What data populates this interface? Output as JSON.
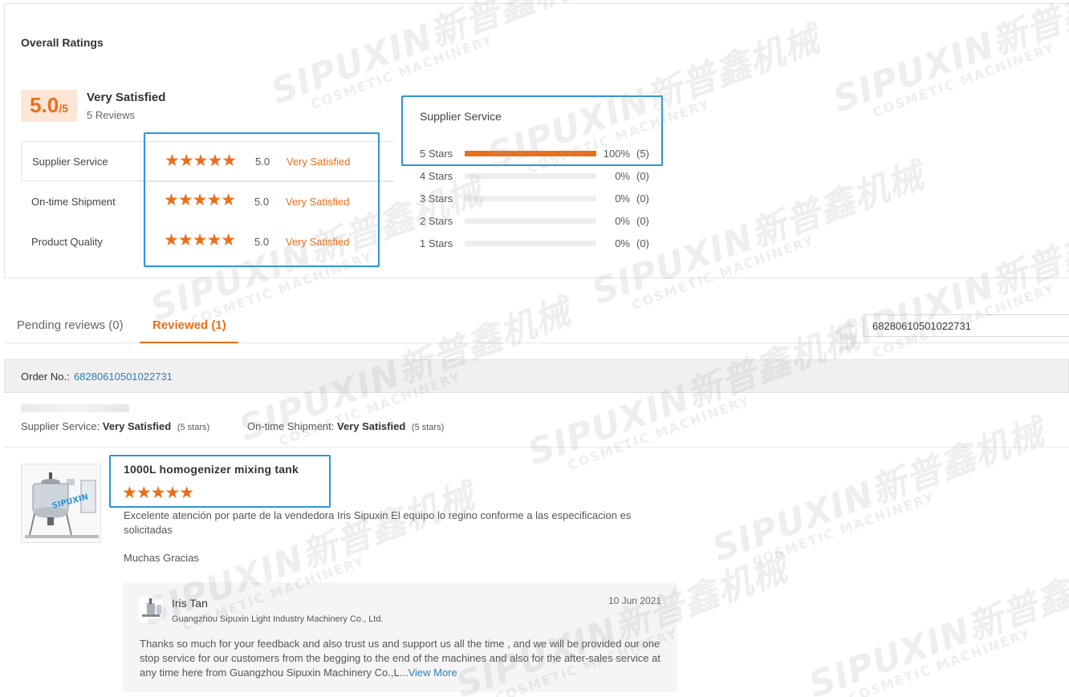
{
  "overall": {
    "title": "Overall Ratings",
    "score": "5.0",
    "score_max": "/5",
    "satisfaction": "Very Satisfied",
    "reviews": "5 Reviews"
  },
  "categories": [
    {
      "label": "Supplier Service",
      "rating": 5,
      "score": "5.0",
      "desc": "Very Satisfied"
    },
    {
      "label": "On-time Shipment",
      "rating": 5,
      "score": "5.0",
      "desc": "Very Satisfied"
    },
    {
      "label": "Product Quality",
      "rating": 5,
      "score": "5.0",
      "desc": "Very Satisfied"
    }
  ],
  "distribution": {
    "title": "Supplier Service",
    "rows": [
      {
        "label": "5  Stars",
        "pct": "100%",
        "count": "(5)",
        "fraction": 1.0
      },
      {
        "label": "4  Stars",
        "pct": "0%",
        "count": "(0)",
        "fraction": 0
      },
      {
        "label": "3  Stars",
        "pct": "0%",
        "count": "(0)",
        "fraction": 0
      },
      {
        "label": "2  Stars",
        "pct": "0%",
        "count": "(0)",
        "fraction": 0
      },
      {
        "label": "1  Stars",
        "pct": "0%",
        "count": "(0)",
        "fraction": 0
      }
    ]
  },
  "tabs": [
    {
      "label": "Pending reviews (0)",
      "active": false
    },
    {
      "label": "Reviewed (1)",
      "active": true
    }
  ],
  "search": {
    "value": "68280610501022731"
  },
  "order": {
    "label": "Order No.:",
    "number": "68280610501022731"
  },
  "summary": {
    "supplier_label": "Supplier Service:",
    "supplier_value": "Very Satisfied",
    "supplier_stars": "(5 stars)",
    "shipment_label": "On-time Shipment:",
    "shipment_value": "Very Satisfied",
    "shipment_stars": "(5 stars)"
  },
  "review": {
    "product": "1000L homogenizer mixing tank",
    "rating": 5,
    "text": "Excelente atención por parte de la vendedora Iris Sipuxin El equipo lo regino conforme a las especificacion es solicitadas",
    "text2": "Muchas Gracias"
  },
  "reply": {
    "name": "Iris Tan",
    "company": "Guangzhou Sipuxin Light Industry Machinery Co., Ltd.",
    "date": "10 Jun 2021",
    "text": "Thanks so much for your feedback and also trust us and support us all the time , and we will be provided our one stop service for our customers from the begging to the end of the machines and also for the after-sales service at any time here from Guangzhou Sipuxin Machinery Co.,L...",
    "more": "View More"
  },
  "watermark": {
    "brand": "SIPUXIN新普鑫机械",
    "sub": "COSMETIC MACHINERY"
  },
  "thumb_label": "SIPUXIN",
  "colors": {
    "accent": "#ea6f1a",
    "highlight": "#2c95d7",
    "link": "#2a7fc1"
  }
}
